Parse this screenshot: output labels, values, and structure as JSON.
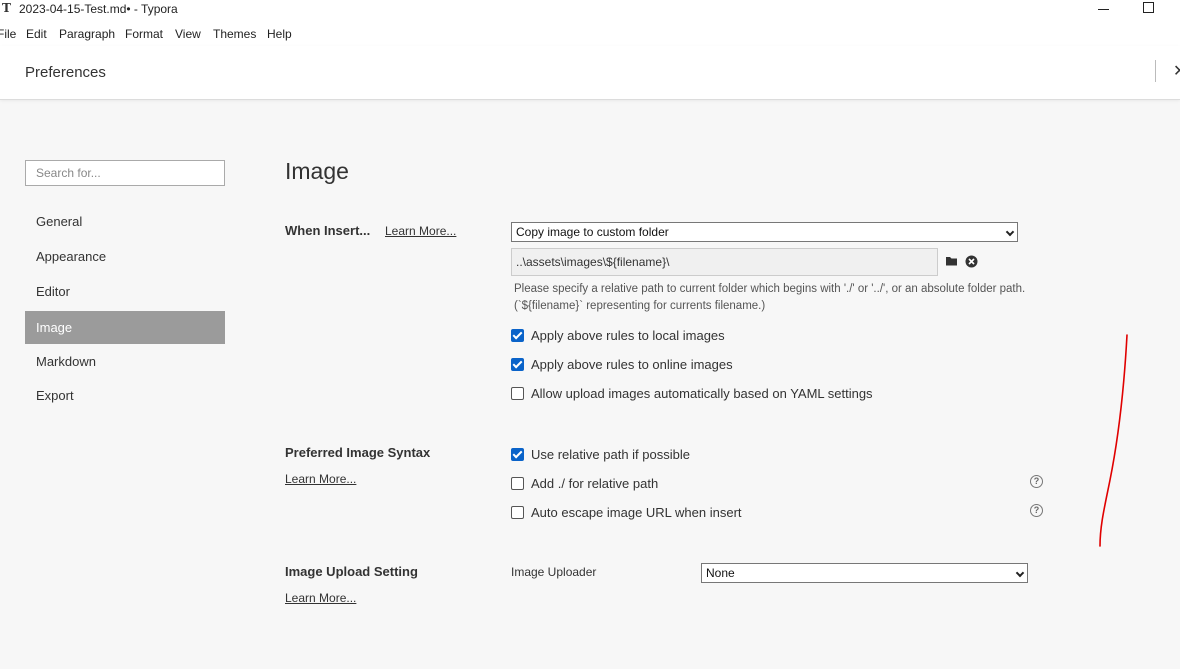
{
  "window": {
    "app_icon": "T",
    "title": "2023-04-15-Test.md• - Typora"
  },
  "menu": [
    "File",
    "Edit",
    "Paragraph",
    "Format",
    "View",
    "Themes",
    "Help"
  ],
  "preferences": {
    "title": "Preferences",
    "close_glyph": "✕"
  },
  "sidebar": {
    "search_placeholder": "Search for...",
    "items": [
      {
        "label": "General"
      },
      {
        "label": "Appearance"
      },
      {
        "label": "Editor"
      },
      {
        "label": "Image",
        "active": true
      },
      {
        "label": "Markdown"
      },
      {
        "label": "Export"
      }
    ]
  },
  "image": {
    "heading": "Image",
    "when_insert": {
      "label": "When Insert...",
      "learn_more": "Learn More...",
      "action_selected": "Copy image to custom folder",
      "path_value": "..\\assets\\images\\${filename}\\",
      "help_text": "Please specify a relative path to current folder which begins with './' or '../', or an absolute folder path. (`${filename}` representing for currents filename.)",
      "options": [
        {
          "label": "Apply above rules to local images",
          "checked": true
        },
        {
          "label": "Apply above rules to online images",
          "checked": true
        },
        {
          "label": "Allow upload images automatically based on YAML settings",
          "checked": false
        }
      ]
    },
    "syntax": {
      "label": "Preferred Image Syntax",
      "learn_more": "Learn More...",
      "options": [
        {
          "label": "Use relative path if possible",
          "checked": true
        },
        {
          "label": "Add ./ for relative path",
          "checked": false,
          "help": true
        },
        {
          "label": "Auto escape image URL when insert",
          "checked": false,
          "help": true
        }
      ]
    },
    "upload": {
      "label": "Image Upload Setting",
      "learn_more": "Learn More...",
      "uploader_label": "Image Uploader",
      "uploader_selected": "None"
    }
  },
  "colors": {
    "checkbox_accent": "#0a63c9",
    "active_nav_bg": "#9b9b9b",
    "annotation_stroke": "#e00000"
  },
  "icons": {
    "folder": "folder-icon",
    "clear": "clear-circle-icon",
    "help": "question-circle-icon",
    "minimize": "minimize-icon",
    "maximize": "maximize-icon",
    "close": "close-icon"
  }
}
